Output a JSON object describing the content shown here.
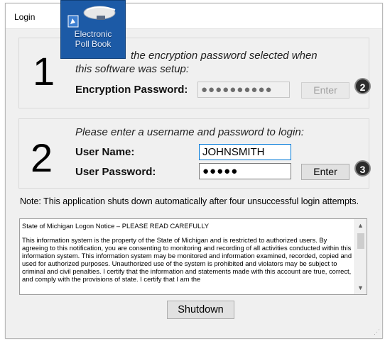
{
  "window": {
    "title": "Login"
  },
  "desktop_icon": {
    "label_line1": "Electronic",
    "label_line2": "Poll Book"
  },
  "step1": {
    "number": "1",
    "instruction_line1": "the encryption password selected when",
    "instruction_line2": "this software was setup:",
    "label": "Encryption Password:",
    "value": "●●●●●●●●●●",
    "button_label": "Enter",
    "badge": "2"
  },
  "step2": {
    "number": "2",
    "instruction": "Please enter a username and password to login:",
    "username_label": "User Name:",
    "username_value": "JOHNSMITH",
    "password_label": "User Password:",
    "password_value": "●●●●●",
    "button_label": "Enter",
    "badge": "3"
  },
  "note": "Note: This application shuts down automatically after four unsuccessful login attempts.",
  "notice": {
    "heading": "State of Michigan Logon Notice – PLEASE READ CAREFULLY",
    "body": "This information system is the property of the State of Michigan and is restricted to authorized users. By agreeing to this notification, you are consenting to monitoring and recording of all activities conducted within this information system. This information system may be monitored and information examined, recorded, copied and used for authorized purposes. Unauthorized use of the system is prohibited and violators may be subject to criminal and civil penalties. I certify that the information and statements made with this account are true, correct, and comply with the provisions of state. I certify that I am the"
  },
  "shutdown_label": "Shutdown",
  "colors": {
    "window_bg": "#f0f0f0",
    "focus_border": "#0078d7",
    "icon_bg": "#1c5aa6"
  }
}
